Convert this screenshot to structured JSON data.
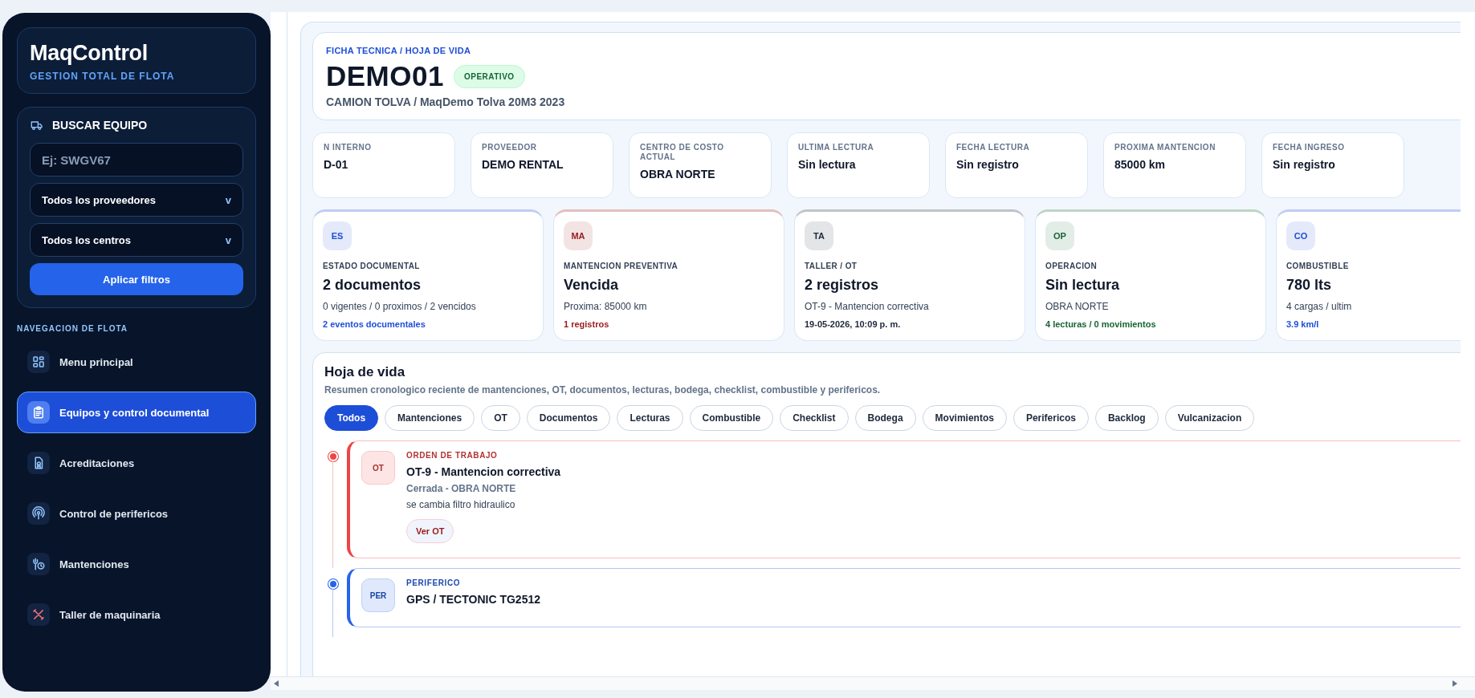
{
  "sidebar": {
    "brand": {
      "title": "MaqControl",
      "subtitle": "GESTION TOTAL DE FLOTA"
    },
    "search": {
      "title": "BUSCAR EQUIPO",
      "placeholder": "Ej: SWGV67",
      "selects": [
        {
          "value": "Todos los proveedores",
          "caret": "v"
        },
        {
          "value": "Todos los centros",
          "caret": "v"
        }
      ],
      "button": "Aplicar filtros"
    },
    "nav": {
      "heading": "NAVEGACION DE FLOTA",
      "items": [
        {
          "label": "Menu principal",
          "kind": "grid",
          "selected": false
        },
        {
          "label": "Equipos y control documental",
          "kind": "clipboard",
          "selected": true
        },
        {
          "label": "Acreditaciones",
          "kind": "badge",
          "selected": false
        },
        {
          "label": "Control de perifericos",
          "kind": "signal",
          "selected": false
        },
        {
          "label": "Mantenciones",
          "kind": "wrench",
          "selected": false
        },
        {
          "label": "Taller de maquinaria",
          "kind": "tools",
          "selected": false
        }
      ]
    }
  },
  "header": {
    "kicker": "FICHA TECNICA / HOJA DE VIDA",
    "code": "DEMO01",
    "status": "OPERATIVO",
    "subtitle": "CAMION TOLVA / MaqDemo Tolva 20M3 2023"
  },
  "info_cards": [
    {
      "label": "N INTERNO",
      "value": "D-01"
    },
    {
      "label": "PROVEEDOR",
      "value": "DEMO RENTAL"
    },
    {
      "label": "CENTRO DE COSTO ACTUAL",
      "value": "OBRA NORTE"
    },
    {
      "label": "ULTIMA LECTURA",
      "value": "Sin lectura"
    },
    {
      "label": "FECHA LECTURA",
      "value": "Sin registro"
    },
    {
      "label": "PROXIMA MANTENCION",
      "value": "85000 km"
    },
    {
      "label": "FECHA INGRESO",
      "value": "Sin registro"
    }
  ],
  "summary_cards": [
    {
      "badge": "ES",
      "label": "ESTADO DOCUMENTAL",
      "value": "2 documentos",
      "detail": "0 vigentes / 0 proximos / 2 vencidos",
      "foot": "2 eventos documentales",
      "color": "#1d4ed8"
    },
    {
      "badge": "MA",
      "label": "MANTENCION PREVENTIVA",
      "value": "Vencida",
      "detail": "Proxima: 85000 km",
      "foot": "1 registros",
      "color": "#991b1b"
    },
    {
      "badge": "TA",
      "label": "TALLER / OT",
      "value": "2 registros",
      "detail": "OT-9 - Mantencion correctiva",
      "foot": "19-05-2026, 10:09 p. m.",
      "color": "#1e293b"
    },
    {
      "badge": "OP",
      "label": "OPERACION",
      "value": "Sin lectura",
      "detail": "OBRA NORTE",
      "foot": "4 lecturas / 0 movimientos",
      "color": "#166534"
    },
    {
      "badge": "CO",
      "label": "COMBUSTIBLE",
      "value": "780 lts",
      "detail": "4 cargas / ultim",
      "foot": "3.9 km/l",
      "color": "#1d4ed8"
    }
  ],
  "timeline": {
    "title": "Hoja de vida",
    "description": "Resumen cronologico reciente de mantenciones, OT, documentos, lecturas, bodega, checklist, combustible y perifericos.",
    "filters": [
      {
        "label": "Todos",
        "selected": true
      },
      {
        "label": "Mantenciones",
        "selected": false
      },
      {
        "label": "OT",
        "selected": false
      },
      {
        "label": "Documentos",
        "selected": false
      },
      {
        "label": "Lecturas",
        "selected": false
      },
      {
        "label": "Combustible",
        "selected": false
      },
      {
        "label": "Checklist",
        "selected": false
      },
      {
        "label": "Bodega",
        "selected": false
      },
      {
        "label": "Movimientos",
        "selected": false
      },
      {
        "label": "Perifericos",
        "selected": false
      },
      {
        "label": "Backlog",
        "selected": false
      },
      {
        "label": "Vulcanizacion",
        "selected": false
      }
    ],
    "entries": [
      {
        "badge": "OT",
        "type": "ORDEN DE TRABAJO",
        "title": "OT-9 - Mantencion correctiva",
        "status": "Cerrada - OBRA NORTE",
        "note": "se cambia filtro hidraulico",
        "action": "Ver OT",
        "color": "#ef4444"
      },
      {
        "badge": "PER",
        "type": "PERIFERICO",
        "title": "GPS / TECTONIC TG2512",
        "color": "#2563eb"
      }
    ]
  }
}
